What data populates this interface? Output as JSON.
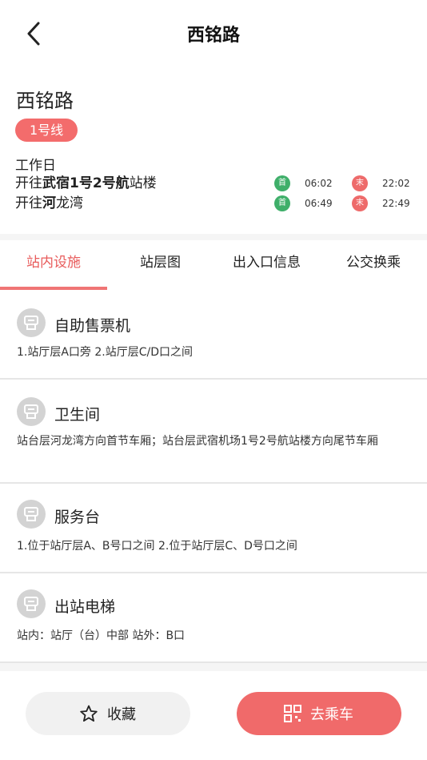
{
  "header": {
    "title": "西铭路",
    "back_icon": "chevron-left-icon"
  },
  "station": {
    "name": "西铭路",
    "line": "1号线",
    "day_type": "工作日",
    "directions": [
      {
        "prefix": "开往",
        "bold": "武宿1号2号航",
        "suffix": "站楼",
        "first_label": "首",
        "first_time": "06:02",
        "last_label": "末",
        "last_time": "22:02"
      },
      {
        "prefix": "开往",
        "bold": "河",
        "suffix": "龙湾",
        "first_label": "首",
        "first_time": "06:49",
        "last_label": "末",
        "last_time": "22:49"
      }
    ],
    "colors": {
      "line_badge": "#f36c6c",
      "first_badge": "#3faf6a",
      "last_badge": "#ee6b6b"
    }
  },
  "tabs": [
    {
      "label": "站内设施",
      "active": true
    },
    {
      "label": "站层图",
      "active": false
    },
    {
      "label": "出入口信息",
      "active": false
    },
    {
      "label": "公交换乘",
      "active": false
    }
  ],
  "facilities": [
    {
      "title": "自助售票机",
      "desc": "1.站厅层A口旁 2.站厅层C/D口之间",
      "icon": "facility-icon"
    },
    {
      "title": "卫生间",
      "desc": "站台层河龙湾方向首节车厢；站台层武宿机场1号2号航站楼方向尾节车厢",
      "icon": "facility-icon"
    },
    {
      "title": "服务台",
      "desc": "1.位于站厅层A、B号口之间 2.位于站厅层C、D号口之间",
      "icon": "facility-icon"
    },
    {
      "title": "出站电梯",
      "desc": "站内：站厅（台）中部 站外：B口",
      "icon": "facility-icon"
    }
  ],
  "bottom": {
    "favorite_label": "收藏",
    "favorite_icon": "star-icon",
    "ride_label": "去乘车",
    "ride_icon": "qr-code-icon"
  },
  "accent_color": "#f06a6a"
}
